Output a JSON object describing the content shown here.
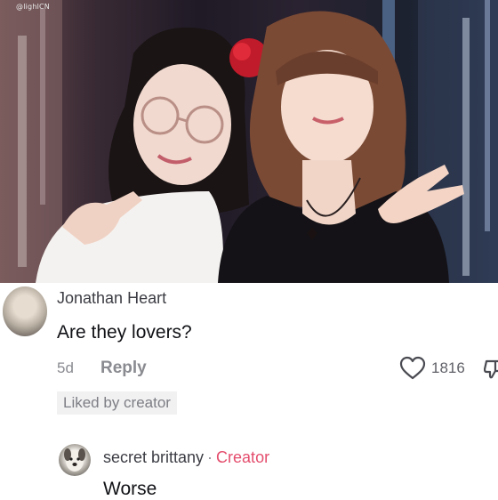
{
  "photo": {
    "watermark": "@lighlCN"
  },
  "comments": [
    {
      "username": "Jonathan Heart",
      "text": "Are they lovers?",
      "age": "5d",
      "reply_label": "Reply",
      "likes": "1816",
      "badge": "Liked by creator"
    },
    {
      "username": "secret brittany",
      "separator": "·",
      "role": "Creator",
      "text": "Worse"
    }
  ],
  "colors": {
    "creator_tag": "#e44d6d",
    "secondary_text": "#8a8b91",
    "primary_text": "#111216"
  },
  "icons": {
    "like": "heart-outline-icon",
    "dislike": "thumbs-down-icon"
  }
}
